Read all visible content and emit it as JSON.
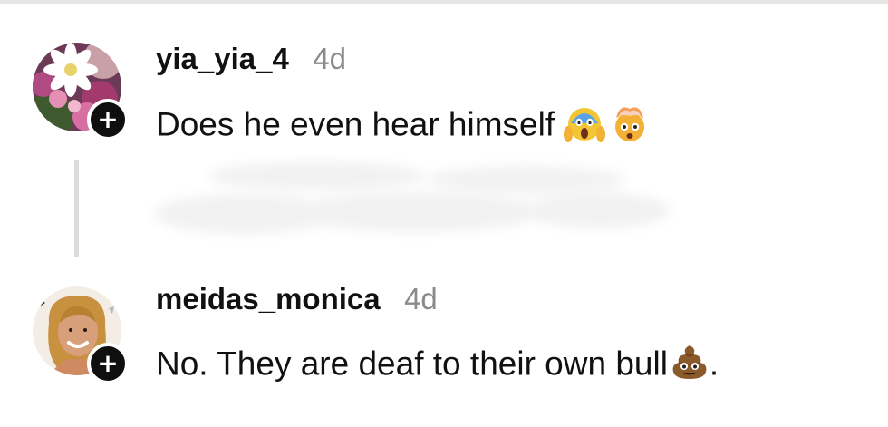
{
  "comments": [
    {
      "username": "yia_yia_4",
      "age": "4d",
      "text": "Does he even hear himself",
      "emojis": [
        "screaming-face-emoji",
        "exploding-head-emoji"
      ],
      "follow_badge": "+"
    },
    {
      "username": "meidas_monica",
      "age": "4d",
      "text": "No. They are deaf to their own bull",
      "text_suffix": ".",
      "emojis": [
        "pile-of-poo-emoji"
      ],
      "follow_badge": "+"
    }
  ],
  "colors": {
    "username": "#111111",
    "timestamp": "#8b8b8b",
    "badge": "#0f0f0f",
    "thread_line": "#dcdcdc"
  }
}
